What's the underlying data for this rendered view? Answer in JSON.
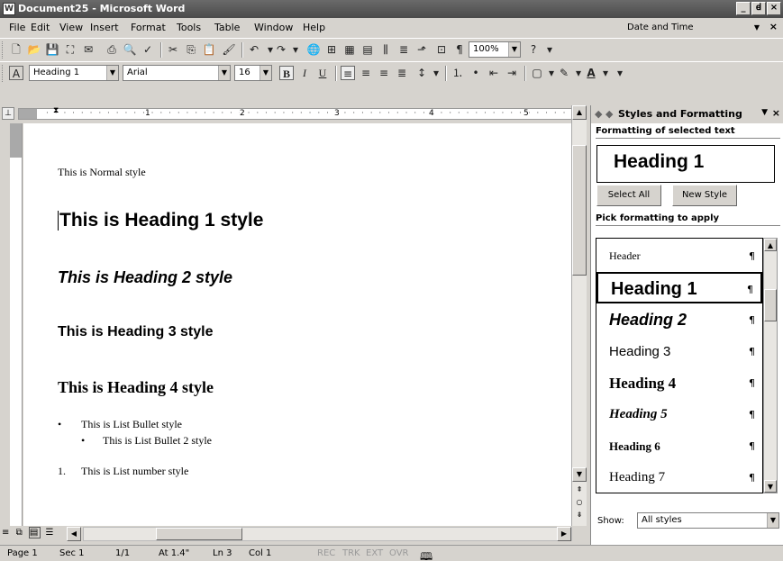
{
  "window": {
    "title": "Document25 - Microsoft Word",
    "buttons": [
      "_",
      "ꟈ",
      "×"
    ]
  },
  "menubar": {
    "items": [
      "File",
      "Edit",
      "View",
      "Insert",
      "Format",
      "Tools",
      "Table",
      "Window",
      "Help"
    ],
    "help_box": "Date and Time",
    "close_doc": "×"
  },
  "formatting_toolbar": {
    "style": "Heading 1",
    "font": "Arial",
    "size": "16",
    "bold": "B",
    "italic": "I",
    "underline": "U"
  },
  "standard_toolbar": {
    "zoom": "100%"
  },
  "ruler": {
    "ticks": [
      "1",
      "2",
      "3",
      "4",
      "5"
    ]
  },
  "document": {
    "lines": [
      "This is Normal style",
      "This is Heading 1 style",
      "This is Heading 2 style",
      "This is Heading 3 style",
      "This is Heading 4 style",
      "This is List Bullet style",
      "This is List Bullet 2 style",
      "This is List number style"
    ],
    "number_prefix": "1."
  },
  "statusbar": {
    "page": "Page 1",
    "sec": "Sec 1",
    "pages": "1/1",
    "at": "At 1.4\"",
    "ln": "Ln 3",
    "col": "Col 1",
    "rec": "REC",
    "trk": "TRK",
    "ext": "EXT",
    "ovr": "OVR"
  },
  "taskpane": {
    "title": "Styles and Formatting",
    "selected_header": "Formatting of selected text",
    "selected_style": "Heading 1",
    "select_all": "Select All",
    "new_style": "New Style",
    "pick_header": "Pick formatting to apply",
    "styles": [
      "Header",
      "Heading 1",
      "Heading 2",
      "Heading 3",
      "Heading 4",
      "Heading 5",
      "Heading 6",
      "Heading 7"
    ],
    "show_label": "Show:",
    "show_value": "All styles"
  },
  "colors": {
    "chrome": "#d6d3ce",
    "titlebar": "#555555"
  }
}
